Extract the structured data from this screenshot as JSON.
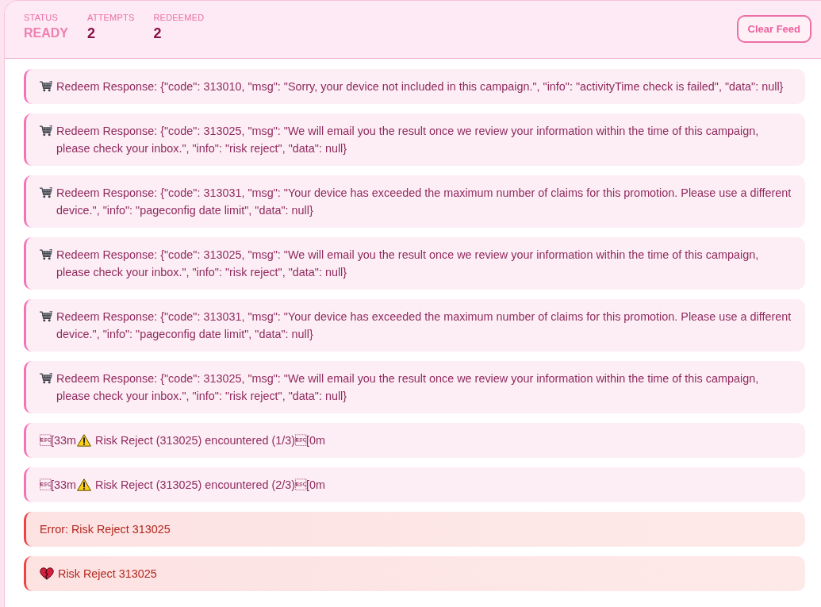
{
  "stats": [
    {
      "label": "STATUS",
      "value": "READY",
      "kind": "status"
    },
    {
      "label": "ATTEMPTS",
      "value": "2",
      "kind": "count"
    },
    {
      "label": "REDEEMED",
      "value": "2",
      "kind": "count"
    }
  ],
  "clear_button": {
    "label": "Clear Feed"
  },
  "feed": [
    {
      "kind": "response",
      "text": "Redeem Response: {\"code\": 313010, \"msg\": \"Sorry, your device not included in this campaign.\", \"info\": \"activityTime check is failed\", \"data\": null}"
    },
    {
      "kind": "response",
      "text": "Redeem Response: {\"code\": 313025, \"msg\": \"We will email you the result once we review your information within the time of this campaign, please check your inbox.\", \"info\": \"risk reject\", \"data\": null}"
    },
    {
      "kind": "response",
      "text": "Redeem Response: {\"code\": 313031, \"msg\": \"Your device has exceeded the maximum number of claims for this promotion. Please use a different device.\", \"info\": \"pageconfig date limit\", \"data\": null}"
    },
    {
      "kind": "response",
      "text": "Redeem Response: {\"code\": 313025, \"msg\": \"We will email you the result once we review your information within the time of this campaign, please check your inbox.\", \"info\": \"risk reject\", \"data\": null}"
    },
    {
      "kind": "response",
      "text": "Redeem Response: {\"code\": 313031, \"msg\": \"Your device has exceeded the maximum number of claims for this promotion. Please use a different device.\", \"info\": \"pageconfig date limit\", \"data\": null}"
    },
    {
      "kind": "response",
      "text": "Redeem Response: {\"code\": 313025, \"msg\": \"We will email you the result once we review your information within the time of this campaign, please check your inbox.\", \"info\": \"risk reject\", \"data\": null}"
    },
    {
      "kind": "warning",
      "prefix": "\u001b[33m",
      "text": "Risk Reject (313025) encountered (1/3)\u001b[0m"
    },
    {
      "kind": "warning",
      "prefix": "\u001b[33m",
      "text": "Risk Reject (313025) encountered (2/3)\u001b[0m"
    },
    {
      "kind": "error",
      "text": "Error: Risk Reject 313025"
    },
    {
      "kind": "failure",
      "text": "Risk Reject 313025"
    }
  ]
}
